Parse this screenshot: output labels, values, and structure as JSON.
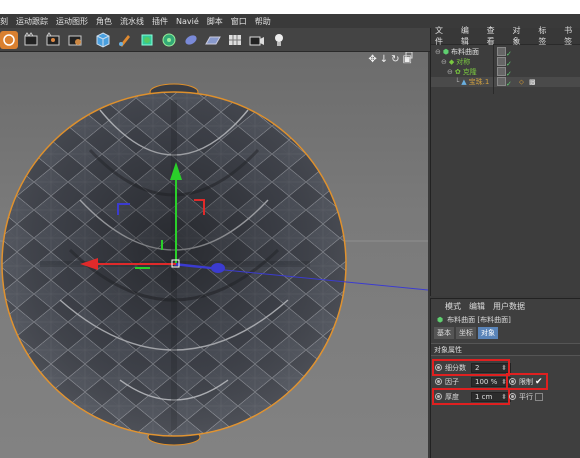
{
  "menu": [
    "刻",
    "运动跟踪",
    "运动图形",
    "角色",
    "流水线",
    "插件",
    "Navié",
    "脚本",
    "窗口",
    "帮助"
  ],
  "object_manager": {
    "menu": [
      "文件",
      "编辑",
      "查看",
      "对象",
      "标签",
      "书签"
    ],
    "rows": [
      {
        "name": "布料曲面",
        "color": "#e0e0e0"
      },
      {
        "name": "对称",
        "color": "#7ac840"
      },
      {
        "name": "克隆",
        "color": "#7ac840"
      },
      {
        "name": "宝珠.1",
        "color": "#d0a040"
      }
    ]
  },
  "attributes": {
    "menu": [
      "模式",
      "编辑",
      "用户数据"
    ],
    "title": "布料曲面 [布料曲面]",
    "tabs": [
      "基本",
      "坐标",
      "对象"
    ],
    "active_tab": "对象",
    "section": "对象属性",
    "subdivisions": {
      "label": "细分数",
      "value": "2"
    },
    "factor": {
      "label": "因子",
      "value": "100 %"
    },
    "thickness": {
      "label": "厚度",
      "value": "1 cm"
    },
    "limit": {
      "label": "限制",
      "checked": "✔"
    },
    "parallel": {
      "label": "平行"
    }
  },
  "colors": {
    "selection_box": "#e02020",
    "active_tab": "#5a84b8",
    "outline": "#e0902a"
  }
}
